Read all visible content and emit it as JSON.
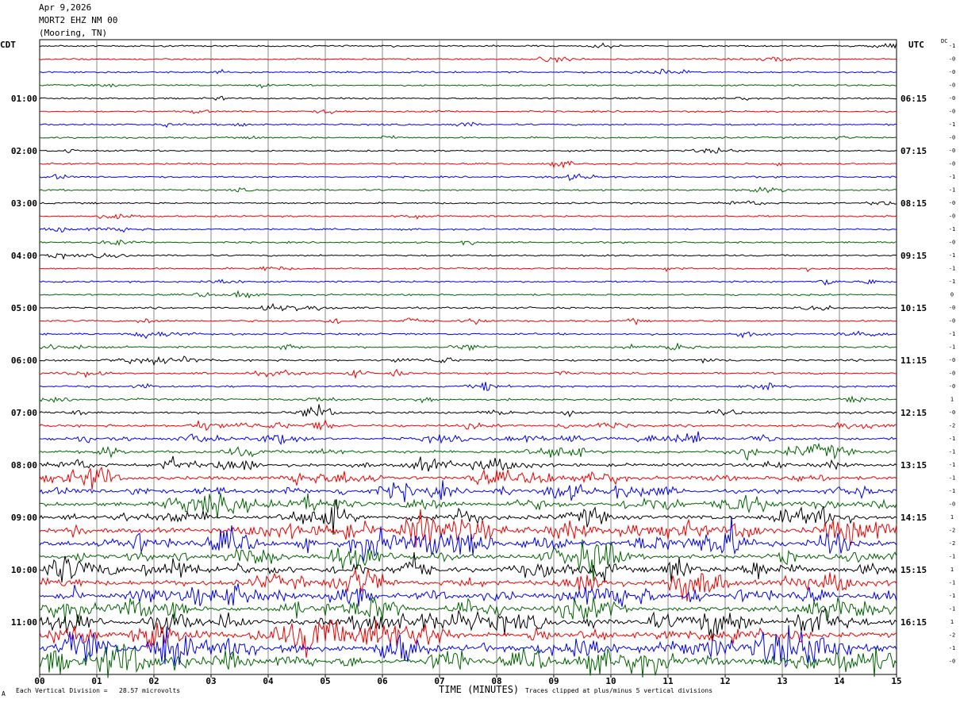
{
  "header": {
    "date": "Apr 9,2026",
    "station": "MORT2 EHZ NM 00",
    "location": "(Mooring, TN)"
  },
  "left_label": "CDT",
  "right_label": "UTC",
  "dc_label": "DC",
  "footer": {
    "scale_note": "Each Vertical Division =   28.57 microvolts",
    "xlabel": "TIME (MINUTES)",
    "clip_note": "Traces clipped at plus/minus 5 vertical divisions",
    "corner_mark": "A"
  },
  "chart_data": {
    "type": "line",
    "subtype": "helicorder",
    "xlabel": "TIME (MINUTES)",
    "xlim": [
      0,
      15
    ],
    "x_ticks": [
      "00",
      "01",
      "02",
      "03",
      "04",
      "05",
      "06",
      "07",
      "08",
      "09",
      "10",
      "11",
      "12",
      "13",
      "14",
      "15"
    ],
    "trace_minutes": 15,
    "trace_colors": [
      "#000000",
      "#ee0000",
      "#0000ee",
      "#006400"
    ],
    "grid": true,
    "left_ticks": [
      {
        "trace": 4,
        "label": "01:00"
      },
      {
        "trace": 8,
        "label": "02:00"
      },
      {
        "trace": 12,
        "label": "03:00"
      },
      {
        "trace": 16,
        "label": "04:00"
      },
      {
        "trace": 20,
        "label": "05:00"
      },
      {
        "trace": 24,
        "label": "06:00"
      },
      {
        "trace": 28,
        "label": "07:00"
      },
      {
        "trace": 32,
        "label": "08:00"
      },
      {
        "trace": 36,
        "label": "09:00"
      },
      {
        "trace": 40,
        "label": "10:00"
      },
      {
        "trace": 44,
        "label": "11:00"
      }
    ],
    "right_ticks": [
      {
        "trace": 4,
        "label": "06:15"
      },
      {
        "trace": 8,
        "label": "07:15"
      },
      {
        "trace": 12,
        "label": "08:15"
      },
      {
        "trace": 16,
        "label": "09:15"
      },
      {
        "trace": 20,
        "label": "10:15"
      },
      {
        "trace": 24,
        "label": "11:15"
      },
      {
        "trace": 28,
        "label": "12:15"
      },
      {
        "trace": 32,
        "label": "13:15"
      },
      {
        "trace": 36,
        "label": "14:15"
      },
      {
        "trace": 40,
        "label": "15:15"
      },
      {
        "trace": 44,
        "label": "16:15"
      }
    ],
    "dc_offsets": [
      "-1",
      "-0",
      "-0",
      "-0",
      "-0",
      "-0",
      "-1",
      "-0",
      "-0",
      "-0",
      "-1",
      "-1",
      "-0",
      "-0",
      "-1",
      "-0",
      "-1",
      "-1",
      "-1",
      "0",
      "-0",
      "-0",
      "-1",
      "-1",
      "-0",
      "-0",
      "-0",
      "1",
      "-0",
      "-2",
      "-1",
      "-1",
      "-1",
      "-1",
      "-1",
      "-0",
      "1",
      "-2",
      "-2",
      "-1",
      "1",
      "-1",
      "-1",
      "-1",
      "1",
      "-2",
      "-1",
      "-0"
    ],
    "activity": [
      0.05,
      0.05,
      0.05,
      0.05,
      0.05,
      0.06,
      0.06,
      0.06,
      0.05,
      0.05,
      0.05,
      0.05,
      0.05,
      0.05,
      0.05,
      0.05,
      0.06,
      0.06,
      0.06,
      0.07,
      0.08,
      0.08,
      0.09,
      0.1,
      0.12,
      0.12,
      0.1,
      0.12,
      0.15,
      0.2,
      0.25,
      0.28,
      0.35,
      0.4,
      0.45,
      0.5,
      0.55,
      0.65,
      0.7,
      0.6,
      0.65,
      0.6,
      0.6,
      0.6,
      0.7,
      0.7,
      0.8,
      0.75
    ],
    "events": [
      {
        "trace": 5,
        "minute": 6.9,
        "amp": 3
      },
      {
        "trace": 6,
        "minute": 2.2,
        "amp": 4
      },
      {
        "trace": 7,
        "minute": 13.9,
        "amp": 5
      },
      {
        "trace": 17,
        "minute": 10.9,
        "amp": 5
      },
      {
        "trace": 18,
        "minute": 13.7,
        "amp": 6
      },
      {
        "trace": 18,
        "minute": 14.5,
        "amp": 8
      },
      {
        "trace": 19,
        "minute": 3.4,
        "amp": 8
      },
      {
        "trace": 21,
        "minute": 1.8,
        "amp": 9
      },
      {
        "trace": 21,
        "minute": 6.4,
        "amp": 14
      },
      {
        "trace": 22,
        "minute": 12.3,
        "amp": 9
      },
      {
        "trace": 23,
        "minute": 10.3,
        "amp": 9
      },
      {
        "trace": 23,
        "minute": 11.1,
        "amp": 7
      },
      {
        "trace": 24,
        "minute": 2.5,
        "amp": 8
      },
      {
        "trace": 24,
        "minute": 6.3,
        "amp": 7
      },
      {
        "trace": 24,
        "minute": 11.6,
        "amp": 10
      },
      {
        "trace": 25,
        "minute": 9.0,
        "amp": 12
      },
      {
        "trace": 29,
        "minute": 4.7,
        "amp": 9
      },
      {
        "trace": 29,
        "minute": 7.5,
        "amp": 10
      },
      {
        "trace": 29,
        "minute": 13.9,
        "amp": 18
      },
      {
        "trace": 30,
        "minute": 9.2,
        "amp": 14
      },
      {
        "trace": 30,
        "minute": 11.4,
        "amp": 12
      },
      {
        "trace": 31,
        "minute": 9.0,
        "amp": 10
      },
      {
        "trace": 33,
        "minute": 7.6,
        "amp": 14
      },
      {
        "trace": 34,
        "minute": 4.3,
        "amp": 14
      }
    ]
  }
}
